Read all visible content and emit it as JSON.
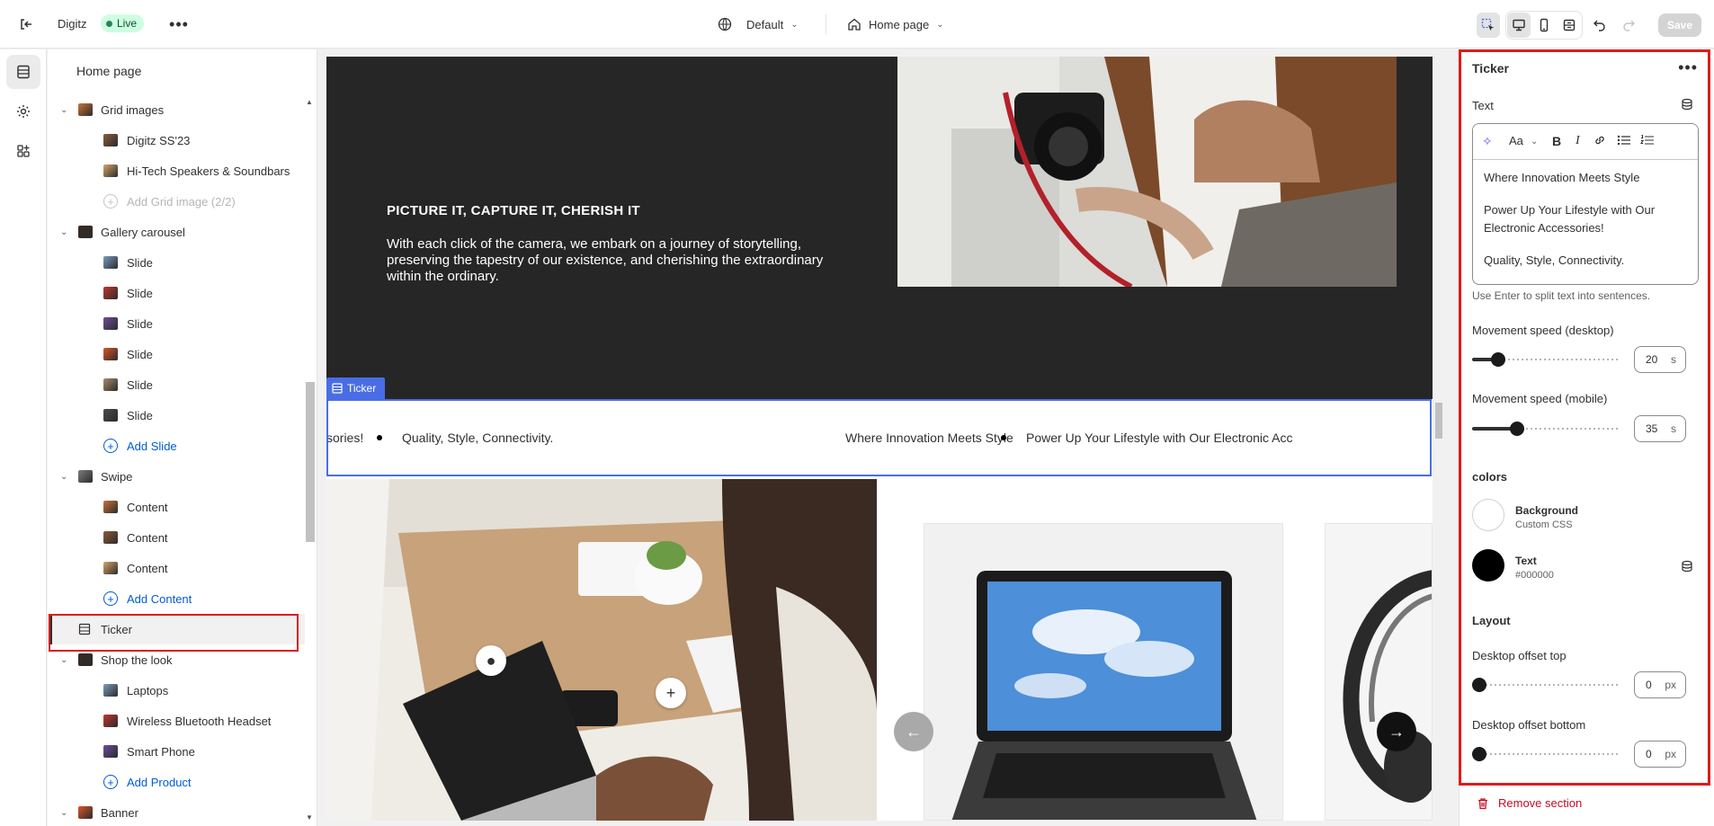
{
  "topbar": {
    "store_name": "Digitz",
    "status_badge": "Live",
    "theme_selector": "Default",
    "page_selector": "Home page",
    "save_label": "Save"
  },
  "sidebar": {
    "title": "Home page",
    "rows": [
      {
        "label": "Grid images",
        "level": 1,
        "kind": "section"
      },
      {
        "label": "Digitz SS'23",
        "level": 2,
        "kind": "block"
      },
      {
        "label": "Hi-Tech Speakers & Soundbars",
        "level": 2,
        "kind": "block"
      },
      {
        "label": "Add Grid image (2/2)",
        "level": 2,
        "kind": "add-disabled"
      },
      {
        "label": "Gallery carousel",
        "level": 1,
        "kind": "section"
      },
      {
        "label": "Slide",
        "level": 2,
        "kind": "block"
      },
      {
        "label": "Slide",
        "level": 2,
        "kind": "block"
      },
      {
        "label": "Slide",
        "level": 2,
        "kind": "block"
      },
      {
        "label": "Slide",
        "level": 2,
        "kind": "block"
      },
      {
        "label": "Slide",
        "level": 2,
        "kind": "block"
      },
      {
        "label": "Slide",
        "level": 2,
        "kind": "block"
      },
      {
        "label": "Add Slide",
        "level": 2,
        "kind": "add"
      },
      {
        "label": "Swipe",
        "level": 1,
        "kind": "section"
      },
      {
        "label": "Content",
        "level": 2,
        "kind": "block"
      },
      {
        "label": "Content",
        "level": 2,
        "kind": "block"
      },
      {
        "label": "Content",
        "level": 2,
        "kind": "block"
      },
      {
        "label": "Add Content",
        "level": 2,
        "kind": "add"
      },
      {
        "label": "Ticker",
        "level": 1,
        "kind": "selected"
      },
      {
        "label": "Shop the look",
        "level": 1,
        "kind": "section"
      },
      {
        "label": "Laptops",
        "level": 2,
        "kind": "block"
      },
      {
        "label": "Wireless Bluetooth Headset",
        "level": 2,
        "kind": "block"
      },
      {
        "label": "Smart Phone",
        "level": 2,
        "kind": "block"
      },
      {
        "label": "Add Product",
        "level": 2,
        "kind": "add"
      },
      {
        "label": "Banner",
        "level": 1,
        "kind": "section"
      }
    ]
  },
  "preview": {
    "hero_title": "PICTURE IT, CAPTURE IT, CHERISH IT",
    "hero_text": "With each click of the camera, we embark on a journey of storytelling, preserving the tapestry of our existence, and cherishing the extraordinary within the ordinary.",
    "ticker_tag": "Ticker",
    "ticker_items": [
      "sories!",
      "Quality, Style, Connectivity.",
      "Where Innovation Meets Style",
      "Power Up Your Lifestyle with Our Electronic Acc"
    ]
  },
  "settings": {
    "title": "Ticker",
    "text_label": "Text",
    "text_lines": [
      "Where Innovation Meets Style",
      "Power Up Your Lifestyle with Our Electronic Accessories!",
      "Quality, Style, Connectivity."
    ],
    "help_text": "Use Enter to split text into sentences.",
    "speed_desktop_label": "Movement speed (desktop)",
    "speed_desktop_value": "20",
    "speed_desktop_unit": "s",
    "speed_desktop_fraction": 0.14,
    "speed_mobile_label": "Movement speed (mobile)",
    "speed_mobile_value": "35",
    "speed_mobile_unit": "s",
    "speed_mobile_fraction": 0.28,
    "colors_heading": "colors",
    "bg_color_name": "Background",
    "bg_color_value": "Custom CSS",
    "text_color_name": "Text",
    "text_color_value": "#000000",
    "layout_heading": "Layout",
    "offset_top_label": "Desktop offset top",
    "offset_top_value": "0",
    "offset_top_unit": "px",
    "offset_bottom_label": "Desktop offset bottom",
    "offset_bottom_value": "0",
    "offset_bottom_unit": "px",
    "remove_label": "Remove section"
  },
  "colors": {
    "accent": "#4a6de5",
    "highlight": "#e01a1a",
    "danger": "#c70a24",
    "link": "#005bd3"
  }
}
